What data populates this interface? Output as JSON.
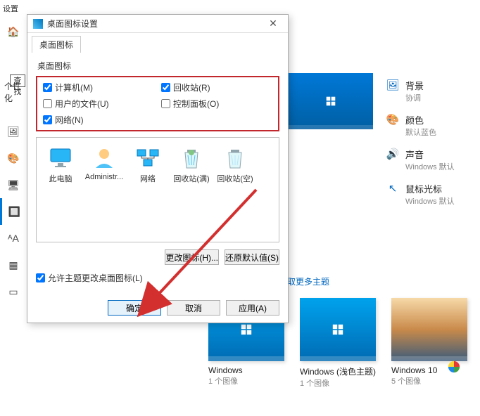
{
  "bg_header": "设置",
  "bg_search_label": "查找",
  "left_section": "个性化",
  "right_items": [
    {
      "icon": "image-icon",
      "label": "背景",
      "sub": "协调"
    },
    {
      "icon": "palette-icon",
      "label": "颜色",
      "sub": "默认蓝色"
    },
    {
      "icon": "speaker-icon",
      "label": "声音",
      "sub": "Windows 默认"
    },
    {
      "icon": "cursor-icon",
      "label": "鼠标光标",
      "sub": "Windows 默认"
    }
  ],
  "more_themes": "取更多主题",
  "themes": [
    {
      "name": "Windows",
      "sub": "1 个图像"
    },
    {
      "name": "Windows (浅色主题)",
      "sub": "1 个图像"
    },
    {
      "name": "Windows 10",
      "sub": "5 个图像"
    }
  ],
  "dialog": {
    "title": "桌面图标设置",
    "tab": "桌面图标",
    "group_label": "桌面图标",
    "checks": {
      "computer": "计算机(M)",
      "recycle": "回收站(R)",
      "userfiles": "用户的文件(U)",
      "controlpanel": "控制面板(O)",
      "network": "网络(N)"
    },
    "checked": {
      "computer": true,
      "recycle": true,
      "userfiles": false,
      "controlpanel": false,
      "network": true
    },
    "icons": [
      "此电脑",
      "Administr...",
      "网络",
      "回收站(满)",
      "回收站(空)"
    ],
    "change_icon": "更改图标(H)...",
    "restore": "还原默认值(S)",
    "allow_themes": "允许主题更改桌面图标(L)",
    "ok": "确定",
    "cancel": "取消",
    "apply": "应用(A)"
  }
}
